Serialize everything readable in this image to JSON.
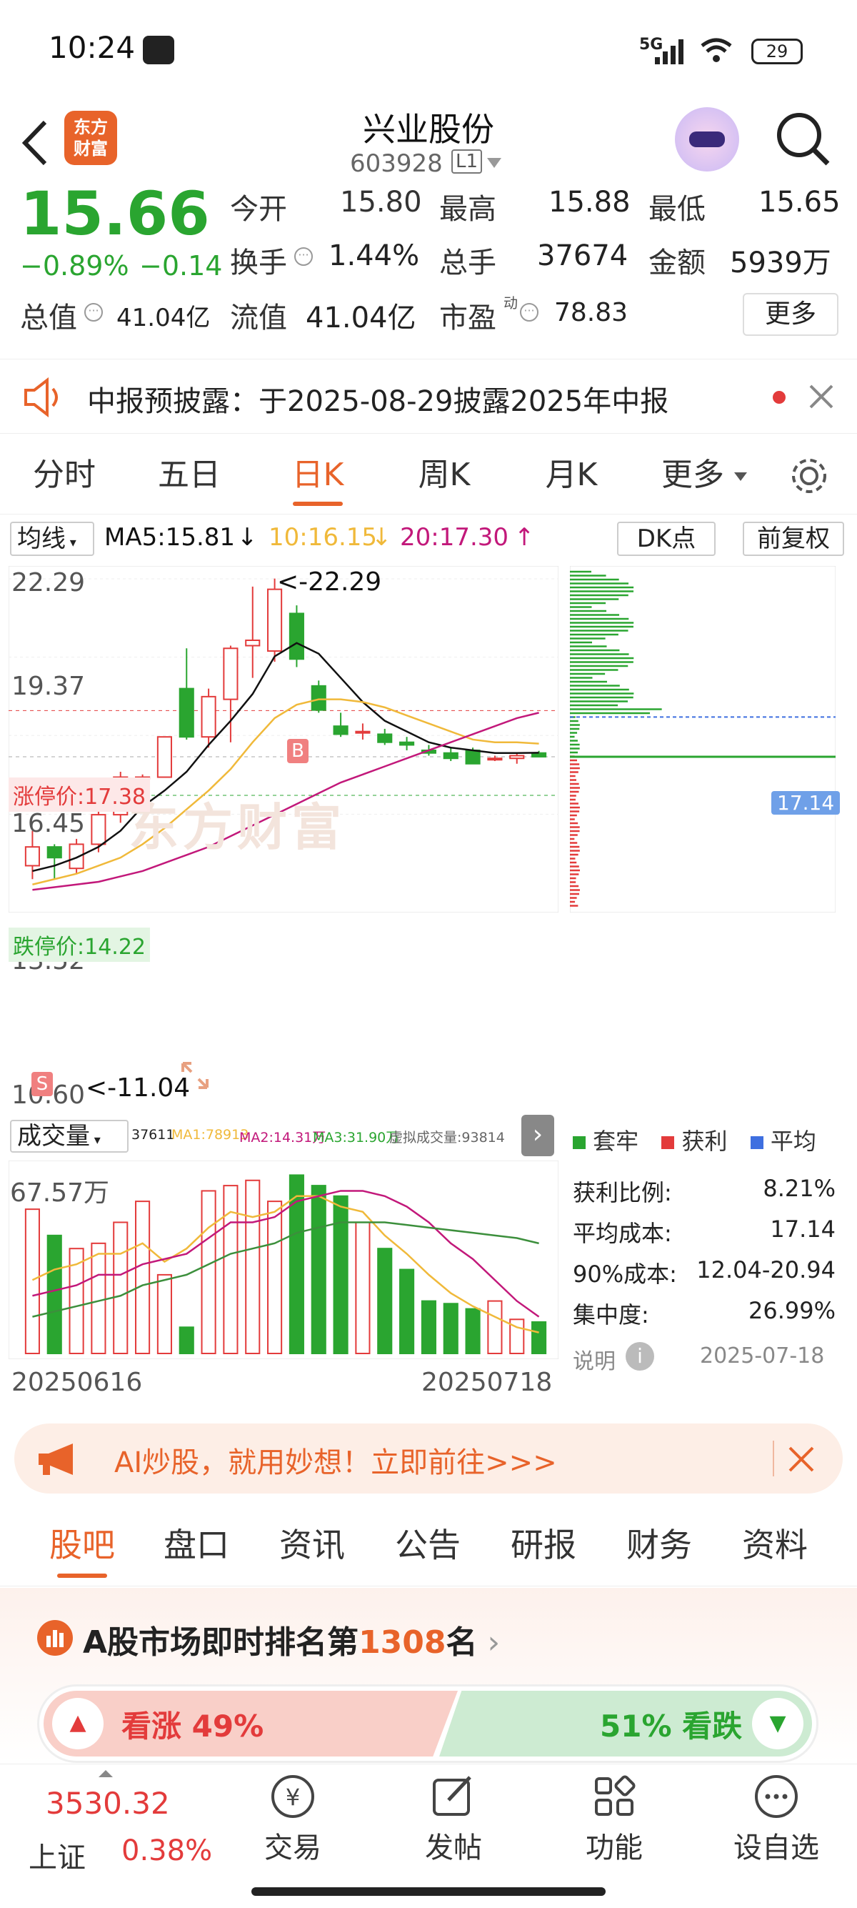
{
  "status": {
    "time": "10:24",
    "network": "5G",
    "battery": "29"
  },
  "header": {
    "title": "兴业股份",
    "code": "603928",
    "level": "L1"
  },
  "quote": {
    "price": "15.66",
    "change_pct": "−0.89%",
    "change": "−0.14",
    "open_label": "今开",
    "open": "15.80",
    "high_label": "最高",
    "high": "15.88",
    "low_label": "最低",
    "low": "15.65",
    "turnover_label": "换手",
    "turnover": "1.44%",
    "vol_label": "总手",
    "vol": "37674",
    "amount_label": "金额",
    "amount": "5939万",
    "mktcap_label": "总值",
    "mktcap": "41.04亿",
    "float_label": "流值",
    "float": "41.04亿",
    "pe_label": "市盈",
    "pe_sup": "动",
    "pe": "78.83",
    "more": "更多"
  },
  "notice": {
    "text": "中报预披露：于2025-08-29披露2025年中报"
  },
  "tabs": [
    "分时",
    "五日",
    "日K",
    "周K",
    "月K",
    "更多"
  ],
  "chart_header": {
    "ma_btn": "均线",
    "ma5": "MA5:15.81",
    "ma10": "10:16.15",
    "ma20": "20:17.30",
    "dk": "DK点",
    "fq": "前复权"
  },
  "kline": {
    "price_labels": [
      "22.29",
      "19.37",
      "16.45",
      "13.52",
      "10.60"
    ],
    "limit_up": "涨停价:17.38",
    "limit_down": "跌停价:14.22",
    "max_marker": "<-22.29",
    "min_marker": "<-11.04",
    "b_marker": "B",
    "s_marker": "S",
    "watermark": "东方财富",
    "chip_price": "17.14"
  },
  "volume_header": {
    "btn": "成交量",
    "vol": "37611",
    "ma1": "MA1:78913",
    "ma2": "MA2:14.31万",
    "ma3": "MA3:31.90万",
    "virtual": "虚拟成交量:93814"
  },
  "volume": {
    "max_label": "67.57万",
    "date_start": "20250616",
    "date_end": "20250718"
  },
  "chip": {
    "legend": [
      "套牢",
      "获利",
      "平均"
    ],
    "rows": [
      [
        "获利比例:",
        "8.21%"
      ],
      [
        "平均成本:",
        "17.14"
      ],
      [
        "90%成本:",
        "12.04-20.94"
      ],
      [
        "集中度:",
        "26.99%"
      ]
    ],
    "note": "说明",
    "date": "2025-07-18"
  },
  "ai_banner": {
    "text": "AI炒股，就用妙想！立即前往>>>"
  },
  "subtabs": [
    "股吧",
    "盘口",
    "资讯",
    "公告",
    "研报",
    "财务",
    "资料"
  ],
  "rank": {
    "prefix": "A股市场即时排名第",
    "rank": "1308",
    "suffix": "名",
    "up_text": "看涨 49%",
    "down_text": "51% 看跌"
  },
  "bottom": {
    "index_value": "3530.32",
    "index_name": "上证",
    "index_change": "0.38%",
    "items": [
      "交易",
      "发帖",
      "功能",
      "设自选"
    ]
  },
  "colors": {
    "up": "#e33b3b",
    "down": "#2aa530",
    "accent": "#e8632a",
    "ma5": "#111111",
    "ma10": "#f0b93a",
    "ma20": "#c2187a"
  },
  "chart_data": {
    "type": "candlestick",
    "title": "",
    "dates_range": [
      "20250616",
      "20250718"
    ],
    "ylim": [
      10.6,
      22.29
    ],
    "candles": [
      {
        "o": 11.6,
        "c": 12.3,
        "h": 12.9,
        "l": 11.1
      },
      {
        "o": 12.3,
        "c": 11.9,
        "h": 12.4,
        "l": 11.1
      },
      {
        "o": 11.5,
        "c": 12.4,
        "h": 12.6,
        "l": 11.3
      },
      {
        "o": 12.4,
        "c": 13.5,
        "h": 13.7,
        "l": 12.1
      },
      {
        "o": 13.5,
        "c": 14.9,
        "h": 15.1,
        "l": 13.2
      },
      {
        "o": 14.9,
        "c": 14.9,
        "h": 15.0,
        "l": 14.8
      },
      {
        "o": 14.9,
        "c": 16.4,
        "h": 16.4,
        "l": 14.9
      },
      {
        "o": 18.2,
        "c": 16.4,
        "h": 19.7,
        "l": 16.3
      },
      {
        "o": 16.4,
        "c": 17.9,
        "h": 18.2,
        "l": 16.0
      },
      {
        "o": 17.8,
        "c": 19.7,
        "h": 19.8,
        "l": 16.2
      },
      {
        "o": 19.8,
        "c": 20.0,
        "h": 22.0,
        "l": 18.6
      },
      {
        "o": 19.6,
        "c": 21.9,
        "h": 22.3,
        "l": 19.2
      },
      {
        "o": 21.0,
        "c": 19.3,
        "h": 21.3,
        "l": 19.0
      },
      {
        "o": 18.3,
        "c": 17.4,
        "h": 18.5,
        "l": 17.3
      },
      {
        "o": 16.8,
        "c": 16.5,
        "h": 17.3,
        "l": 16.4
      },
      {
        "o": 16.6,
        "c": 16.6,
        "h": 16.9,
        "l": 16.3
      },
      {
        "o": 16.5,
        "c": 16.2,
        "h": 16.7,
        "l": 16.1
      },
      {
        "o": 16.2,
        "c": 16.1,
        "h": 16.4,
        "l": 15.9
      },
      {
        "o": 15.9,
        "c": 15.8,
        "h": 16.1,
        "l": 15.7
      },
      {
        "o": 15.8,
        "c": 15.6,
        "h": 16.0,
        "l": 15.5
      },
      {
        "o": 15.9,
        "c": 15.4,
        "h": 16.0,
        "l": 15.4
      },
      {
        "o": 15.6,
        "c": 15.6,
        "h": 15.7,
        "l": 15.5
      },
      {
        "o": 15.6,
        "c": 15.7,
        "h": 15.8,
        "l": 15.4
      },
      {
        "o": 15.8,
        "c": 15.66,
        "h": 15.88,
        "l": 15.65
      }
    ],
    "ma5": [
      11.4,
      11.6,
      11.9,
      12.3,
      12.9,
      13.8,
      14.4,
      15.1,
      16.1,
      17.0,
      18.0,
      19.4,
      19.9,
      19.5,
      18.6,
      17.7,
      17.0,
      16.6,
      16.2,
      16.0,
      15.9,
      15.8,
      15.8,
      15.81
    ],
    "ma10": [
      10.9,
      11.1,
      11.3,
      11.6,
      11.9,
      12.4,
      13.0,
      13.7,
      14.4,
      15.2,
      16.2,
      17.1,
      17.6,
      17.8,
      17.8,
      17.7,
      17.5,
      17.2,
      16.9,
      16.6,
      16.3,
      16.2,
      16.2,
      16.15
    ],
    "ma20": [
      10.7,
      10.8,
      10.9,
      11.0,
      11.2,
      11.4,
      11.7,
      12.0,
      12.3,
      12.7,
      13.1,
      13.5,
      13.9,
      14.3,
      14.7,
      15.0,
      15.3,
      15.6,
      15.9,
      16.2,
      16.5,
      16.8,
      17.1,
      17.3
    ],
    "volume": {
      "ylim": [
        0,
        67.57
      ],
      "unit": "万",
      "values": [
        55,
        45,
        40,
        42,
        50,
        58,
        30,
        10,
        62,
        64,
        66,
        58,
        68,
        64,
        60,
        50,
        40,
        32,
        20,
        19,
        17,
        20,
        13,
        12
      ],
      "ma1": [
        28,
        32,
        34,
        38,
        38,
        42,
        35,
        40,
        48,
        54,
        52,
        54,
        60,
        60,
        56,
        54,
        45,
        38,
        30,
        23,
        18,
        14,
        10,
        8
      ],
      "ma2": [
        22,
        24,
        26,
        30,
        30,
        34,
        36,
        38,
        44,
        50,
        50,
        52,
        58,
        60,
        62,
        62,
        60,
        56,
        50,
        42,
        36,
        28,
        20,
        14
      ],
      "ma3": [
        14,
        16,
        18,
        20,
        22,
        26,
        28,
        30,
        34,
        38,
        40,
        42,
        46,
        48,
        50,
        50,
        50,
        49,
        48,
        47,
        46,
        45,
        44,
        42
      ]
    }
  }
}
